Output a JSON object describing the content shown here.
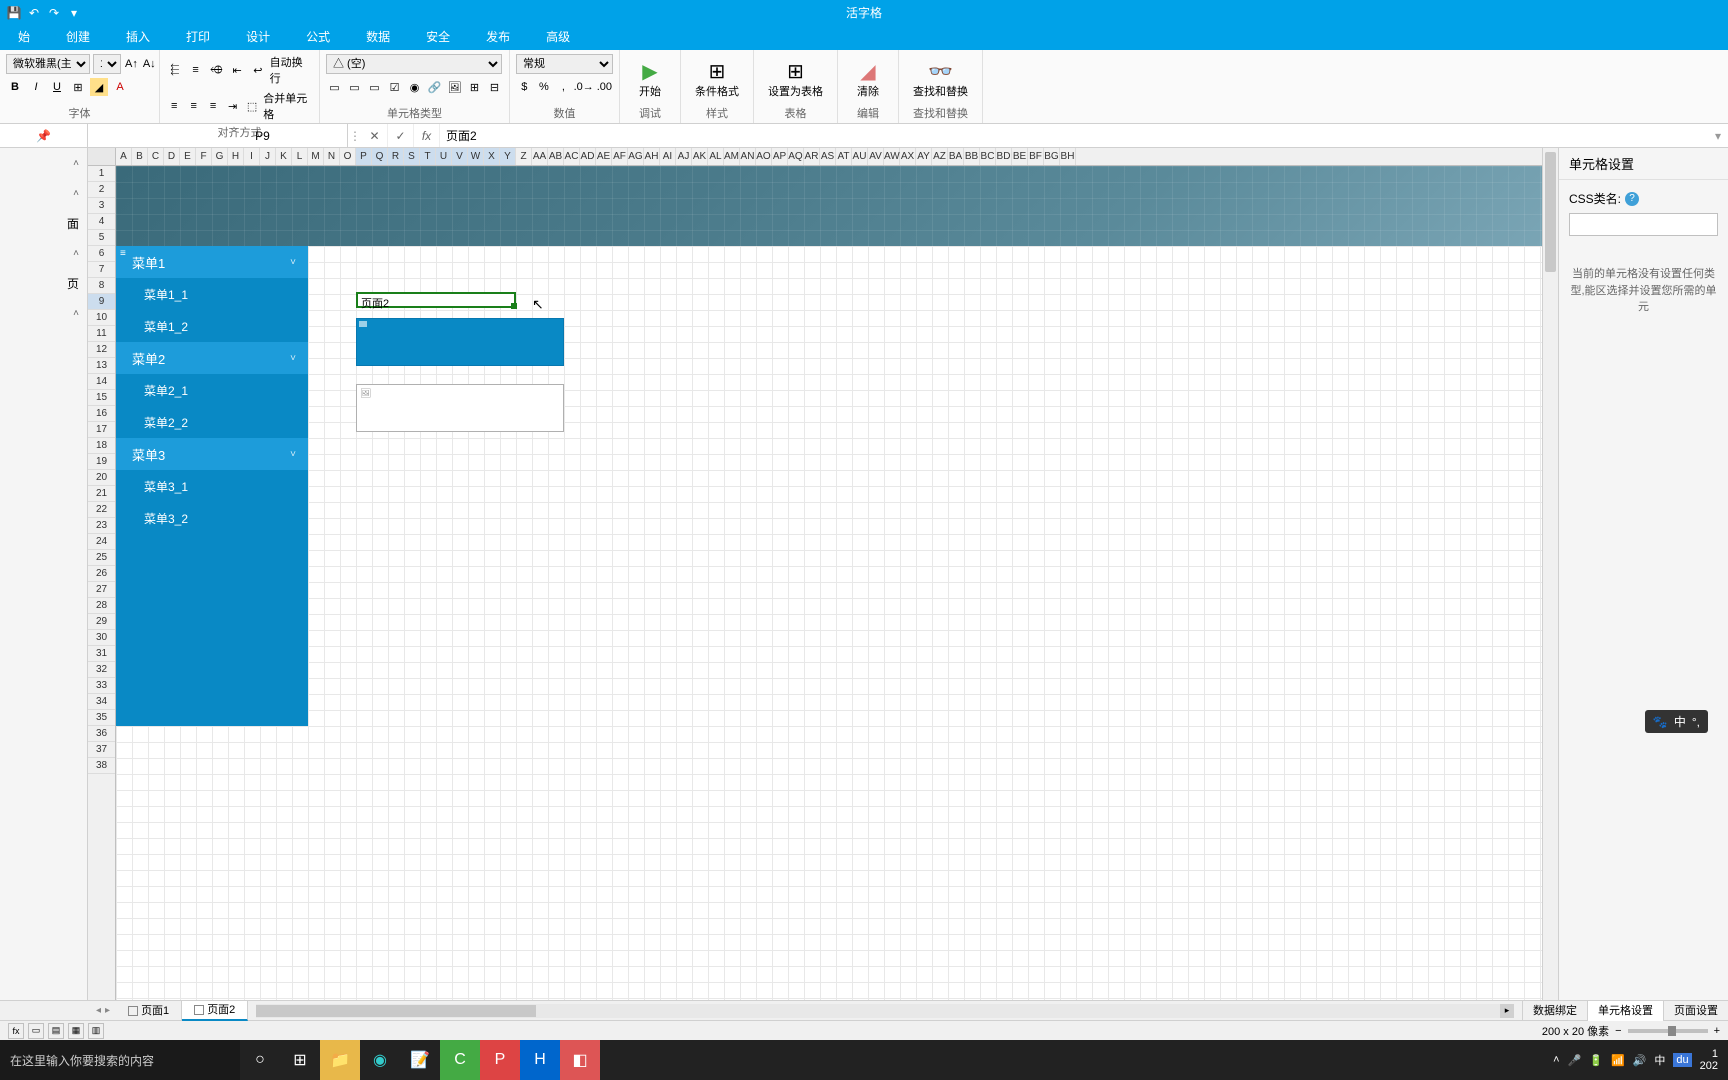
{
  "app": {
    "title": "活字格"
  },
  "qat": {
    "save": "💾",
    "undo": "↶",
    "redo": "↷",
    "dd": "▾"
  },
  "tabs": [
    "始",
    "创建",
    "插入",
    "打印",
    "设计",
    "公式",
    "数据",
    "安全",
    "发布",
    "高级"
  ],
  "ribbon": {
    "font": {
      "label": "字体",
      "family": "微软雅黑(主题字",
      "size": "11",
      "bold": "B",
      "italic": "I",
      "underline": "U"
    },
    "align": {
      "label": "对齐方式",
      "wrap": "自动换行",
      "merge": "合并单元格"
    },
    "celltype": {
      "label": "单元格类型",
      "placeholder": "△ (空)"
    },
    "number": {
      "label": "数值",
      "format": "常规"
    },
    "debug": {
      "label": "调试",
      "btn": "开始"
    },
    "style": {
      "label": "样式",
      "btn": "条件格式"
    },
    "table": {
      "label": "表格",
      "btn": "设置为表格"
    },
    "edit": {
      "label": "编辑",
      "btn": "清除"
    },
    "find": {
      "label": "查找和替换",
      "btn": "查找和替换"
    }
  },
  "leftpanel": {
    "items": [
      "",
      "",
      "面",
      "",
      "页",
      ""
    ]
  },
  "formula": {
    "cell": "P9",
    "fx": "fx",
    "value": "页面2"
  },
  "columns": [
    "A",
    "B",
    "C",
    "D",
    "E",
    "F",
    "G",
    "H",
    "I",
    "J",
    "K",
    "L",
    "M",
    "N",
    "O",
    "P",
    "Q",
    "R",
    "S",
    "T",
    "U",
    "V",
    "W",
    "X",
    "Y",
    "Z",
    "AA",
    "AB",
    "AC",
    "AD",
    "AE",
    "AF",
    "AG",
    "AH",
    "AI",
    "AJ",
    "AK",
    "AL",
    "AM",
    "AN",
    "AO",
    "AP",
    "AQ",
    "AR",
    "AS",
    "AT",
    "AU",
    "AV",
    "AW",
    "AX",
    "AY",
    "AZ",
    "BA",
    "BB",
    "BC",
    "BD",
    "BE",
    "BF",
    "BG",
    "BH"
  ],
  "rows_count": 38,
  "selected_row": 9,
  "selected_cols": [
    "P",
    "Q",
    "R",
    "S",
    "T",
    "U",
    "V",
    "W",
    "X",
    "Y"
  ],
  "menu": [
    {
      "label": "菜单1",
      "type": "top"
    },
    {
      "label": "菜单1_1",
      "type": "sub"
    },
    {
      "label": "菜单1_2",
      "type": "sub"
    },
    {
      "label": "菜单2",
      "type": "top"
    },
    {
      "label": "菜单2_1",
      "type": "sub"
    },
    {
      "label": "菜单2_2",
      "type": "sub"
    },
    {
      "label": "菜单3",
      "type": "top"
    },
    {
      "label": "菜单3_1",
      "type": "sub"
    },
    {
      "label": "菜单3_2",
      "type": "sub"
    }
  ],
  "cell_content": "页面2",
  "sheets": [
    {
      "name": "页面1",
      "active": false
    },
    {
      "name": "页面2",
      "active": true
    }
  ],
  "right": {
    "title": "单元格设置",
    "css_label": "CSS类名:",
    "hint": "当前的单元格没有设置任何类型,能区选择并设置您所需的单元"
  },
  "br_tabs": [
    "数据绑定",
    "单元格设置",
    "页面设置"
  ],
  "status": {
    "dims": "200 x 20 像素"
  },
  "ime": {
    "paw": "🐾",
    "lang": "中",
    "sym": "°,"
  },
  "taskbar": {
    "search": "在这里输入你要搜索的内容",
    "tray_time": "1",
    "tray_date": "202",
    "lang": "中",
    "du": "du"
  }
}
